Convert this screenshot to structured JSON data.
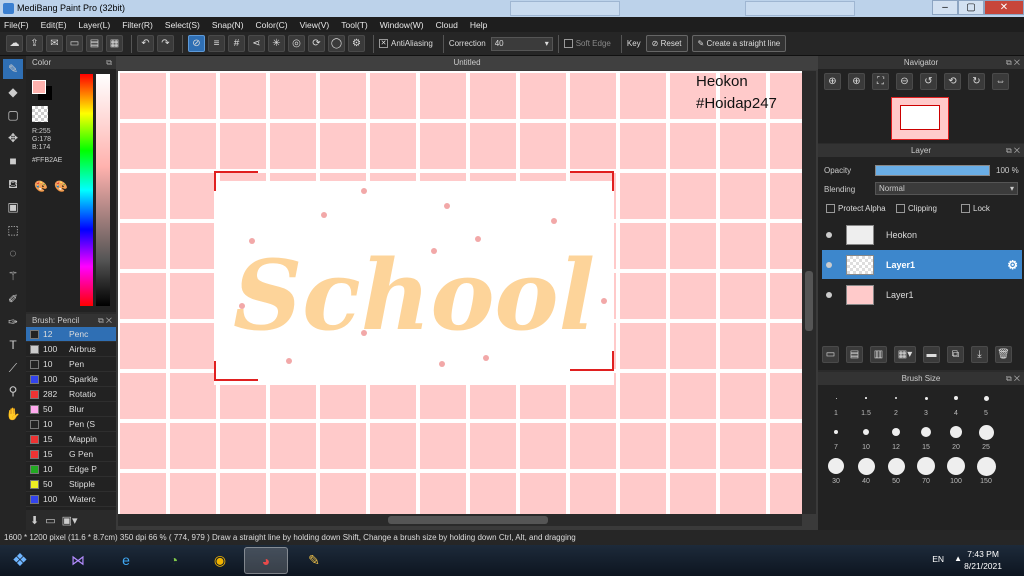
{
  "window": {
    "title": "MediBang Paint Pro (32bit)",
    "bg_tabs": [
      "",
      ""
    ],
    "controls": [
      "–",
      "▢",
      "✕"
    ]
  },
  "menu": [
    "File(F)",
    "Edit(E)",
    "Layer(L)",
    "Filter(R)",
    "Select(S)",
    "Snap(N)",
    "Color(C)",
    "View(V)",
    "Tool(T)",
    "Window(W)",
    "Cloud",
    "Help"
  ],
  "toolbar": {
    "antialiasing": "AntiAliasing",
    "correction_label": "Correction",
    "correction_value": "40",
    "soft_edge": "Soft Edge",
    "key_label": "Key",
    "reset": "Reset",
    "straight_line": "Create a straight line"
  },
  "color_panel": {
    "title": "Color",
    "r": "R:255",
    "g": "G:178",
    "b": "B:174",
    "hex": "#FFB2AE",
    "fg": "#ffb2ae"
  },
  "brush_panel": {
    "title": "Brush: Pencil",
    "items": [
      {
        "size": "12",
        "name": "Penc",
        "color": "#222222"
      },
      {
        "size": "100",
        "name": "Airbrus",
        "color": "#cccccc"
      },
      {
        "size": "10",
        "name": "Pen",
        "color": "#222222"
      },
      {
        "size": "100",
        "name": "Sparkle",
        "color": "#3344ee"
      },
      {
        "size": "282",
        "name": "Rotatio",
        "color": "#ee3333"
      },
      {
        "size": "50",
        "name": "Blur",
        "color": "#ffaaee"
      },
      {
        "size": "10",
        "name": "Pen (S",
        "color": "#222222"
      },
      {
        "size": "15",
        "name": "Mappin",
        "color": "#ee3333"
      },
      {
        "size": "15",
        "name": "G Pen",
        "color": "#ee3333"
      },
      {
        "size": "10",
        "name": "Edge P",
        "color": "#22aa22"
      },
      {
        "size": "50",
        "name": "Stipple",
        "color": "#eeee22"
      },
      {
        "size": "100",
        "name": "Waterc",
        "color": "#3344ee"
      }
    ]
  },
  "document": {
    "tab": "Untitled",
    "watermark_line1": "Heokon",
    "watermark_line2": "#Hoidap247",
    "artwork_text": "School"
  },
  "navigator": {
    "title": "Navigator"
  },
  "layer_panel": {
    "title": "Layer",
    "opacity_label": "Opacity",
    "opacity_value": "100 %",
    "blending_label": "Blending",
    "blending_value": "Normal",
    "protect_alpha": "Protect Alpha",
    "clipping": "Clipping",
    "lock": "Lock",
    "layers": [
      {
        "name": "Heokon",
        "selected": false
      },
      {
        "name": "Layer1",
        "selected": true
      },
      {
        "name": "Layer1",
        "selected": false
      }
    ]
  },
  "brush_size": {
    "title": "Brush Size",
    "sizes": [
      "1",
      "1.5",
      "2",
      "3",
      "4",
      "5",
      "7",
      "10",
      "12",
      "15",
      "20",
      "25",
      "30",
      "40",
      "50",
      "70",
      "100",
      "150"
    ]
  },
  "status": {
    "text": "1600 * 1200 pixel  (11.6 * 8.7cm)  350 dpi  66 %  ( 774, 979 )  Draw a straight line by holding down Shift, Change a brush size by holding down Ctrl, Alt, and dragging"
  },
  "taskbar": {
    "lang": "EN",
    "time": "7:43 PM",
    "date": "8/21/2021"
  }
}
